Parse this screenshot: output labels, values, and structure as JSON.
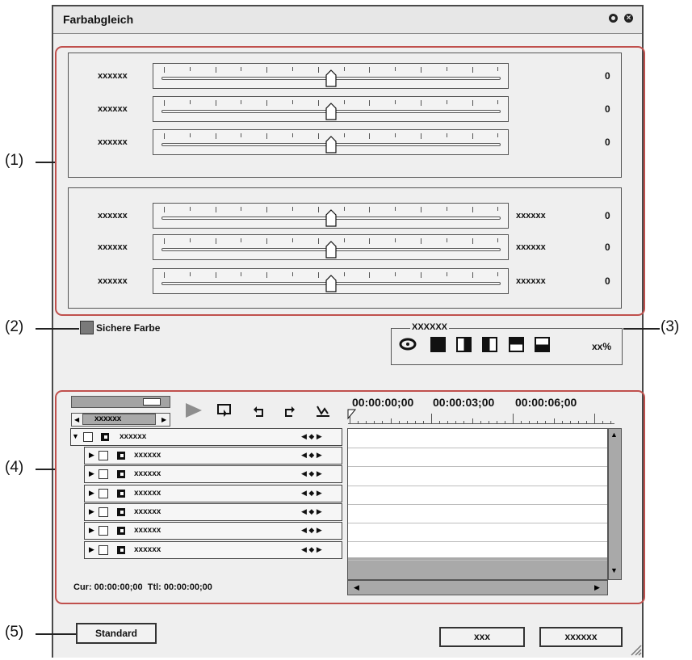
{
  "window": {
    "title": "Farbabgleich"
  },
  "callouts": [
    "(1)",
    "(2)",
    "(3)",
    "(4)",
    "(5)"
  ],
  "sliders": {
    "top": [
      {
        "label": "xxxxxx",
        "value": "0",
        "position": 0.5
      },
      {
        "label": "xxxxxx",
        "value": "0",
        "position": 0.5
      },
      {
        "label": "xxxxxx",
        "value": "0",
        "position": 0.5
      }
    ],
    "bottom": [
      {
        "label": "xxxxxx",
        "right_label": "xxxxxx",
        "value": "0",
        "position": 0.5
      },
      {
        "label": "xxxxxx",
        "right_label": "xxxxxx",
        "value": "0",
        "position": 0.5
      },
      {
        "label": "xxxxxx",
        "right_label": "xxxxxx",
        "value": "0",
        "position": 0.5
      }
    ]
  },
  "safe_color": {
    "label": "Sichere Farbe",
    "checked": false
  },
  "preview": {
    "group_label": "XXXXXX",
    "percent": "xx%"
  },
  "keyframe": {
    "nav_label": "xxxxxx",
    "parent": "xxxxxx",
    "rows": [
      "xxxxxx",
      "xxxxxx",
      "xxxxxx",
      "xxxxxx",
      "xxxxxx",
      "xxxxxx"
    ],
    "timecodes": [
      "00:00:00;00",
      "00:00:03;00",
      "00:00:06;00"
    ],
    "cur_label": "Cur:",
    "cur_value": "00:00:00;00",
    "ttl_label": "Ttl:",
    "ttl_value": "00:00:00;00"
  },
  "footer": {
    "standard": "Standard",
    "ok": "xxx",
    "cancel": "xxxxxx"
  },
  "colors": {
    "callout": "#c0504d",
    "panel_bg": "#efefef",
    "swatch": "#7a7a7a",
    "timeline_fill": "#a9a9a9"
  }
}
